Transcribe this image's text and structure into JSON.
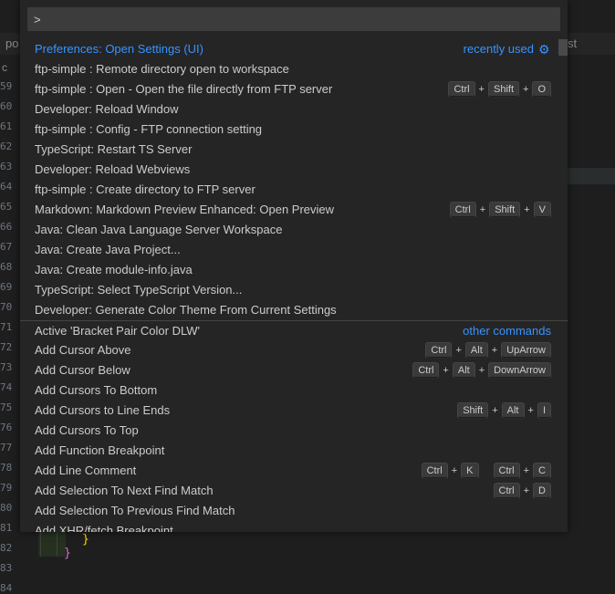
{
  "editor": {
    "tab_fragment_left": "po",
    "tab_fragment_right": "st",
    "breadcrumb_fragment": "c",
    "line_numbers": [
      "59",
      "60",
      "61",
      "62",
      "63",
      "64",
      "65",
      "66",
      "67",
      "68",
      "69",
      "70",
      "71",
      "72",
      "73",
      "74",
      "75",
      "76",
      "77",
      "78",
      "79",
      "80",
      "81",
      "82",
      "83",
      "84"
    ],
    "closing_brace": "}",
    "closing_brace_2": "}"
  },
  "palette": {
    "input_value": ">",
    "items": [
      {
        "label": "Preferences: Open Settings (UI)",
        "group": "recently used",
        "gear": true,
        "selected": true
      },
      {
        "label": "ftp-simple : Remote directory open to workspace"
      },
      {
        "label": "ftp-simple : Open - Open the file directly from FTP server",
        "keys": [
          [
            "Ctrl",
            "Shift",
            "O"
          ]
        ]
      },
      {
        "label": "Developer: Reload Window"
      },
      {
        "label": "ftp-simple : Config - FTP connection setting"
      },
      {
        "label": "TypeScript: Restart TS Server"
      },
      {
        "label": "Developer: Reload Webviews"
      },
      {
        "label": "ftp-simple : Create directory to FTP server"
      },
      {
        "label": "Markdown: Markdown Preview Enhanced: Open Preview",
        "keys": [
          [
            "Ctrl",
            "Shift",
            "V"
          ]
        ]
      },
      {
        "label": "Java: Clean Java Language Server Workspace"
      },
      {
        "label": "Java: Create Java Project..."
      },
      {
        "label": "Java: Create module-info.java"
      },
      {
        "label": "TypeScript: Select TypeScript Version..."
      },
      {
        "label": "Developer: Generate Color Theme From Current Settings"
      },
      {
        "label": "Active 'Bracket Pair Color DLW'",
        "group": "other commands",
        "separator": true
      },
      {
        "label": "Add Cursor Above",
        "keys": [
          [
            "Ctrl",
            "Alt",
            "UpArrow"
          ]
        ]
      },
      {
        "label": "Add Cursor Below",
        "keys": [
          [
            "Ctrl",
            "Alt",
            "DownArrow"
          ]
        ]
      },
      {
        "label": "Add Cursors To Bottom"
      },
      {
        "label": "Add Cursors to Line Ends",
        "keys": [
          [
            "Shift",
            "Alt",
            "I"
          ]
        ]
      },
      {
        "label": "Add Cursors To Top"
      },
      {
        "label": "Add Function Breakpoint"
      },
      {
        "label": "Add Line Comment",
        "keys": [
          [
            "Ctrl",
            "K"
          ],
          [
            "Ctrl",
            "C"
          ]
        ]
      },
      {
        "label": "Add Selection To Next Find Match",
        "keys": [
          [
            "Ctrl",
            "D"
          ]
        ]
      },
      {
        "label": "Add Selection To Previous Find Match"
      },
      {
        "label": "Add XHR/fetch Breakpoint"
      }
    ],
    "gear_icon_glyph": "⚙",
    "plus_glyph": "+"
  }
}
